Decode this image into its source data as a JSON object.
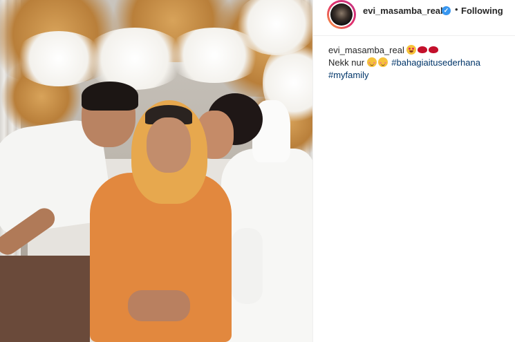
{
  "post": {
    "username": "evi_masamba_real",
    "verified_icon": "verified-badge-icon",
    "separator": "•",
    "follow_status": "Following"
  },
  "caption": {
    "username": "evi_masamba_real",
    "line1_emojis": [
      "heart-eyes-emoji",
      "lips-emoji",
      "lips-emoji"
    ],
    "line2_text": "Nekk nur",
    "line2_emojis": [
      "blush-emoji",
      "blush-emoji"
    ],
    "hashtag1": "#bahagiaitusederhana",
    "hashtag2": "#myfamily"
  },
  "colors": {
    "verified": "#3897f0",
    "hashtag": "#003569",
    "text": "#262626"
  }
}
